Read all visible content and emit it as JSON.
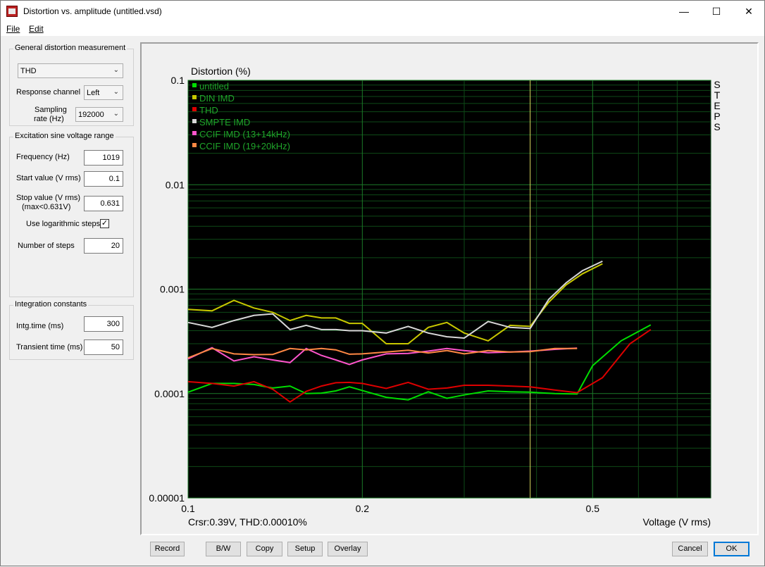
{
  "window": {
    "title": "Distortion vs. amplitude (untitled.vsd)",
    "minimize": "—",
    "maximize": "☐",
    "close": "✕"
  },
  "menu": {
    "file": "File",
    "edit": "Edit"
  },
  "general": {
    "title": "General distortion measurement",
    "measurement_value": "THD",
    "response_channel_label": "Response channel",
    "response_channel_value": "Left",
    "sampling_rate_label_1": "Sampling",
    "sampling_rate_label_2": "rate (Hz)",
    "sampling_rate_value": "192000"
  },
  "excitation": {
    "title": "Excitation sine voltage range",
    "frequency_label": "Frequency (Hz)",
    "frequency_value": "1019",
    "start_label": "Start value (V rms)",
    "start_value": "0.1",
    "stop_label_1": "Stop value (V rms)",
    "stop_label_2": "(max<0.631V)",
    "stop_value": "0.631",
    "log_steps_label": "Use logarithmic steps",
    "log_steps_checked": "✓",
    "steps_label": "Number of steps",
    "steps_value": "20"
  },
  "integration": {
    "title": "Integration constants",
    "intg_label": "Intg.time (ms)",
    "intg_value": "300",
    "transient_label": "Transient time (ms)",
    "transient_value": "50"
  },
  "buttons": {
    "record": "Record",
    "bw": "B/W",
    "copy": "Copy",
    "setup": "Setup",
    "overlay": "Overlay",
    "cancel": "Cancel",
    "ok": "OK"
  },
  "plot": {
    "cursor_text": "Crsr:0.39V, THD:0.00010%",
    "steps_letters": [
      "S",
      "T",
      "E",
      "P",
      "S"
    ]
  },
  "chart_data": {
    "type": "line",
    "ylabel": "Distortion (%)",
    "xlabel": "Voltage (V rms)",
    "x_scale": "log",
    "y_scale": "log",
    "xlim": [
      0.1,
      0.8
    ],
    "ylim": [
      1e-05,
      0.1
    ],
    "x_ticks": [
      0.1,
      0.2,
      0.5
    ],
    "x_tick_labels": [
      "0.1",
      "0.2",
      "0.5"
    ],
    "y_ticks": [
      0.1,
      0.01,
      0.001,
      0.0001,
      1e-05
    ],
    "y_tick_labels": [
      "0.1",
      "0.01",
      "0.001",
      "0.0001",
      "0.00001"
    ],
    "grid": true,
    "legend_position": "top-left",
    "cursor_x": 0.39,
    "background": "#000000",
    "grid_color": "#0e4a17",
    "series": [
      {
        "name": "untitled",
        "color": "#00dd00",
        "x": [
          0.1,
          0.11,
          0.12,
          0.13,
          0.14,
          0.15,
          0.16,
          0.17,
          0.18,
          0.19,
          0.2,
          0.22,
          0.24,
          0.26,
          0.28,
          0.3,
          0.33,
          0.36,
          0.39,
          0.43,
          0.47,
          0.5,
          0.56,
          0.63
        ],
        "y": [
          0.000103,
          0.000125,
          0.000125,
          0.000122,
          0.000113,
          0.000118,
          0.0001,
          0.000101,
          0.000106,
          0.000116,
          0.000107,
          9.2e-05,
          8.7e-05,
          0.000104,
          9e-05,
          9.7e-05,
          0.000106,
          0.000104,
          0.000103,
          0.0001,
          9.9e-05,
          0.000185,
          0.00032,
          0.000455
        ]
      },
      {
        "name": "DIN IMD",
        "color": "#c8c800",
        "x": [
          0.1,
          0.11,
          0.12,
          0.13,
          0.14,
          0.15,
          0.16,
          0.17,
          0.18,
          0.19,
          0.2,
          0.22,
          0.24,
          0.26,
          0.28,
          0.3,
          0.33,
          0.36,
          0.39,
          0.42,
          0.45,
          0.48,
          0.52
        ],
        "y": [
          0.00064,
          0.00062,
          0.00078,
          0.00066,
          0.0006,
          0.0005,
          0.00056,
          0.00053,
          0.00053,
          0.00047,
          0.00047,
          0.0003,
          0.0003,
          0.00043,
          0.00048,
          0.00038,
          0.00032,
          0.00045,
          0.00044,
          0.00075,
          0.0011,
          0.0014,
          0.00175
        ]
      },
      {
        "name": "THD",
        "color": "#dd0000",
        "x": [
          0.1,
          0.11,
          0.12,
          0.13,
          0.14,
          0.15,
          0.16,
          0.17,
          0.18,
          0.19,
          0.2,
          0.22,
          0.24,
          0.26,
          0.28,
          0.3,
          0.33,
          0.36,
          0.39,
          0.43,
          0.47,
          0.52,
          0.58,
          0.63
        ],
        "y": [
          0.00013,
          0.000125,
          0.000118,
          0.00013,
          0.00011,
          8.3e-05,
          0.000105,
          0.000118,
          0.000127,
          0.000128,
          0.000125,
          0.000112,
          0.000128,
          0.00011,
          0.000113,
          0.00012,
          0.00012,
          0.000118,
          0.000116,
          0.000108,
          0.000102,
          0.000142,
          0.0003,
          0.00041
        ]
      },
      {
        "name": "SMPTE IMD",
        "color": "#d8d8d8",
        "x": [
          0.1,
          0.11,
          0.12,
          0.13,
          0.14,
          0.15,
          0.16,
          0.17,
          0.18,
          0.19,
          0.2,
          0.22,
          0.24,
          0.26,
          0.28,
          0.3,
          0.33,
          0.36,
          0.39,
          0.42,
          0.45,
          0.48,
          0.52
        ],
        "y": [
          0.00048,
          0.00043,
          0.0005,
          0.00056,
          0.00058,
          0.00041,
          0.00045,
          0.00041,
          0.00041,
          0.0004,
          0.0004,
          0.00038,
          0.00044,
          0.00038,
          0.00035,
          0.00034,
          0.00049,
          0.00043,
          0.00042,
          0.0008,
          0.00115,
          0.0015,
          0.00185
        ]
      },
      {
        "name": "CCIF IMD (13+14kHz)",
        "color": "#ff55cc",
        "x": [
          0.1,
          0.11,
          0.12,
          0.13,
          0.14,
          0.15,
          0.16,
          0.17,
          0.18,
          0.19,
          0.2,
          0.22,
          0.24,
          0.26,
          0.28,
          0.3,
          0.33,
          0.36,
          0.39,
          0.43,
          0.47
        ],
        "y": [
          0.000215,
          0.000275,
          0.000205,
          0.000225,
          0.00021,
          0.000198,
          0.00027,
          0.000232,
          0.00021,
          0.00019,
          0.00021,
          0.00024,
          0.000242,
          0.000255,
          0.00027,
          0.000258,
          0.000246,
          0.00025,
          0.000255,
          0.000265,
          0.000272
        ]
      },
      {
        "name": "CCIF IMD (19+20kHz)",
        "color": "#ff8844",
        "x": [
          0.1,
          0.11,
          0.12,
          0.13,
          0.14,
          0.15,
          0.16,
          0.17,
          0.18,
          0.19,
          0.2,
          0.22,
          0.24,
          0.26,
          0.28,
          0.3,
          0.33,
          0.36,
          0.39,
          0.43,
          0.47
        ],
        "y": [
          0.00022,
          0.00027,
          0.00024,
          0.000236,
          0.000237,
          0.00027,
          0.000262,
          0.00027,
          0.000262,
          0.000238,
          0.00024,
          0.00025,
          0.00026,
          0.000245,
          0.000258,
          0.00024,
          0.000258,
          0.00025,
          0.000252,
          0.00027,
          0.00027
        ]
      }
    ]
  }
}
